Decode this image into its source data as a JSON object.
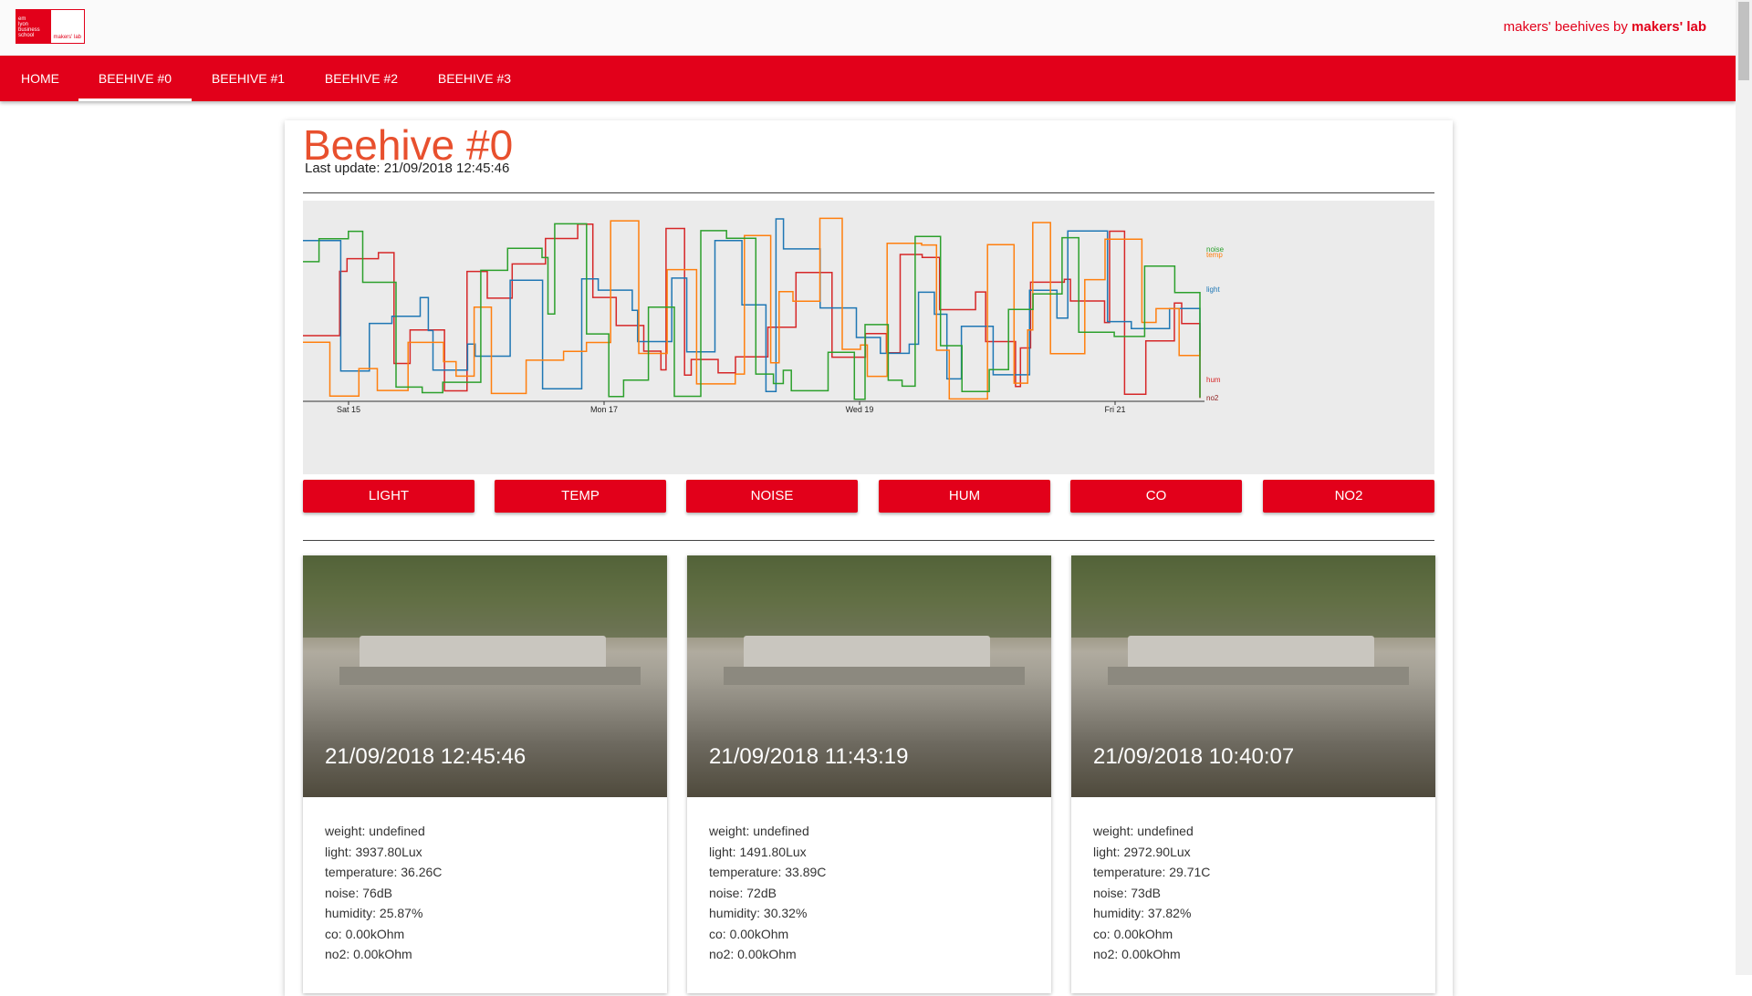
{
  "header": {
    "logo_text": [
      "em",
      "lyon",
      "business",
      "school"
    ],
    "logo_lab": "makers' lab",
    "brand_prefix": "makers' beehives by",
    "brand_name": "makers' lab"
  },
  "nav": {
    "items": [
      {
        "label": "HOME",
        "active": false
      },
      {
        "label": "BEEHIVE #0",
        "active": true
      },
      {
        "label": "BEEHIVE #1",
        "active": false
      },
      {
        "label": "BEEHIVE #2",
        "active": false
      },
      {
        "label": "BEEHIVE #3",
        "active": false
      }
    ]
  },
  "page": {
    "title": "Beehive #0",
    "last_update": "Last update: 21/09/2018 12:45:46"
  },
  "chart_data": {
    "type": "line",
    "x_ticks": [
      "Sat 15",
      "Mon 17",
      "Wed 19",
      "Fri 21"
    ],
    "series_labels": [
      "noise",
      "temp",
      "light",
      "hum",
      "no2"
    ],
    "colors": {
      "light": "#1f77b4",
      "temp": "#ff7f0e",
      "noise": "#2ca02c",
      "hum": "#d62728",
      "no2": "#8c1c1c"
    },
    "grid": false
  },
  "sensor_buttons": [
    "LIGHT",
    "TEMP",
    "NOISE",
    "HUM",
    "CO",
    "NO2"
  ],
  "snapshots": [
    {
      "timestamp": "21/09/2018 12:45:46",
      "readings": [
        "weight: undefined",
        "light: 3937.80Lux",
        "temperature: 36.26C",
        "noise: 76dB",
        "humidity: 25.87%",
        "co: 0.00kOhm",
        "no2: 0.00kOhm"
      ]
    },
    {
      "timestamp": "21/09/2018 11:43:19",
      "readings": [
        "weight: undefined",
        "light: 1491.80Lux",
        "temperature: 33.89C",
        "noise: 72dB",
        "humidity: 30.32%",
        "co: 0.00kOhm",
        "no2: 0.00kOhm"
      ]
    },
    {
      "timestamp": "21/09/2018 10:40:07",
      "readings": [
        "weight: undefined",
        "light: 2972.90Lux",
        "temperature: 29.71C",
        "noise: 73dB",
        "humidity: 37.82%",
        "co: 0.00kOhm",
        "no2: 0.00kOhm"
      ]
    }
  ],
  "colors": {
    "accent": "#e2001a",
    "title": "#e8502e"
  }
}
